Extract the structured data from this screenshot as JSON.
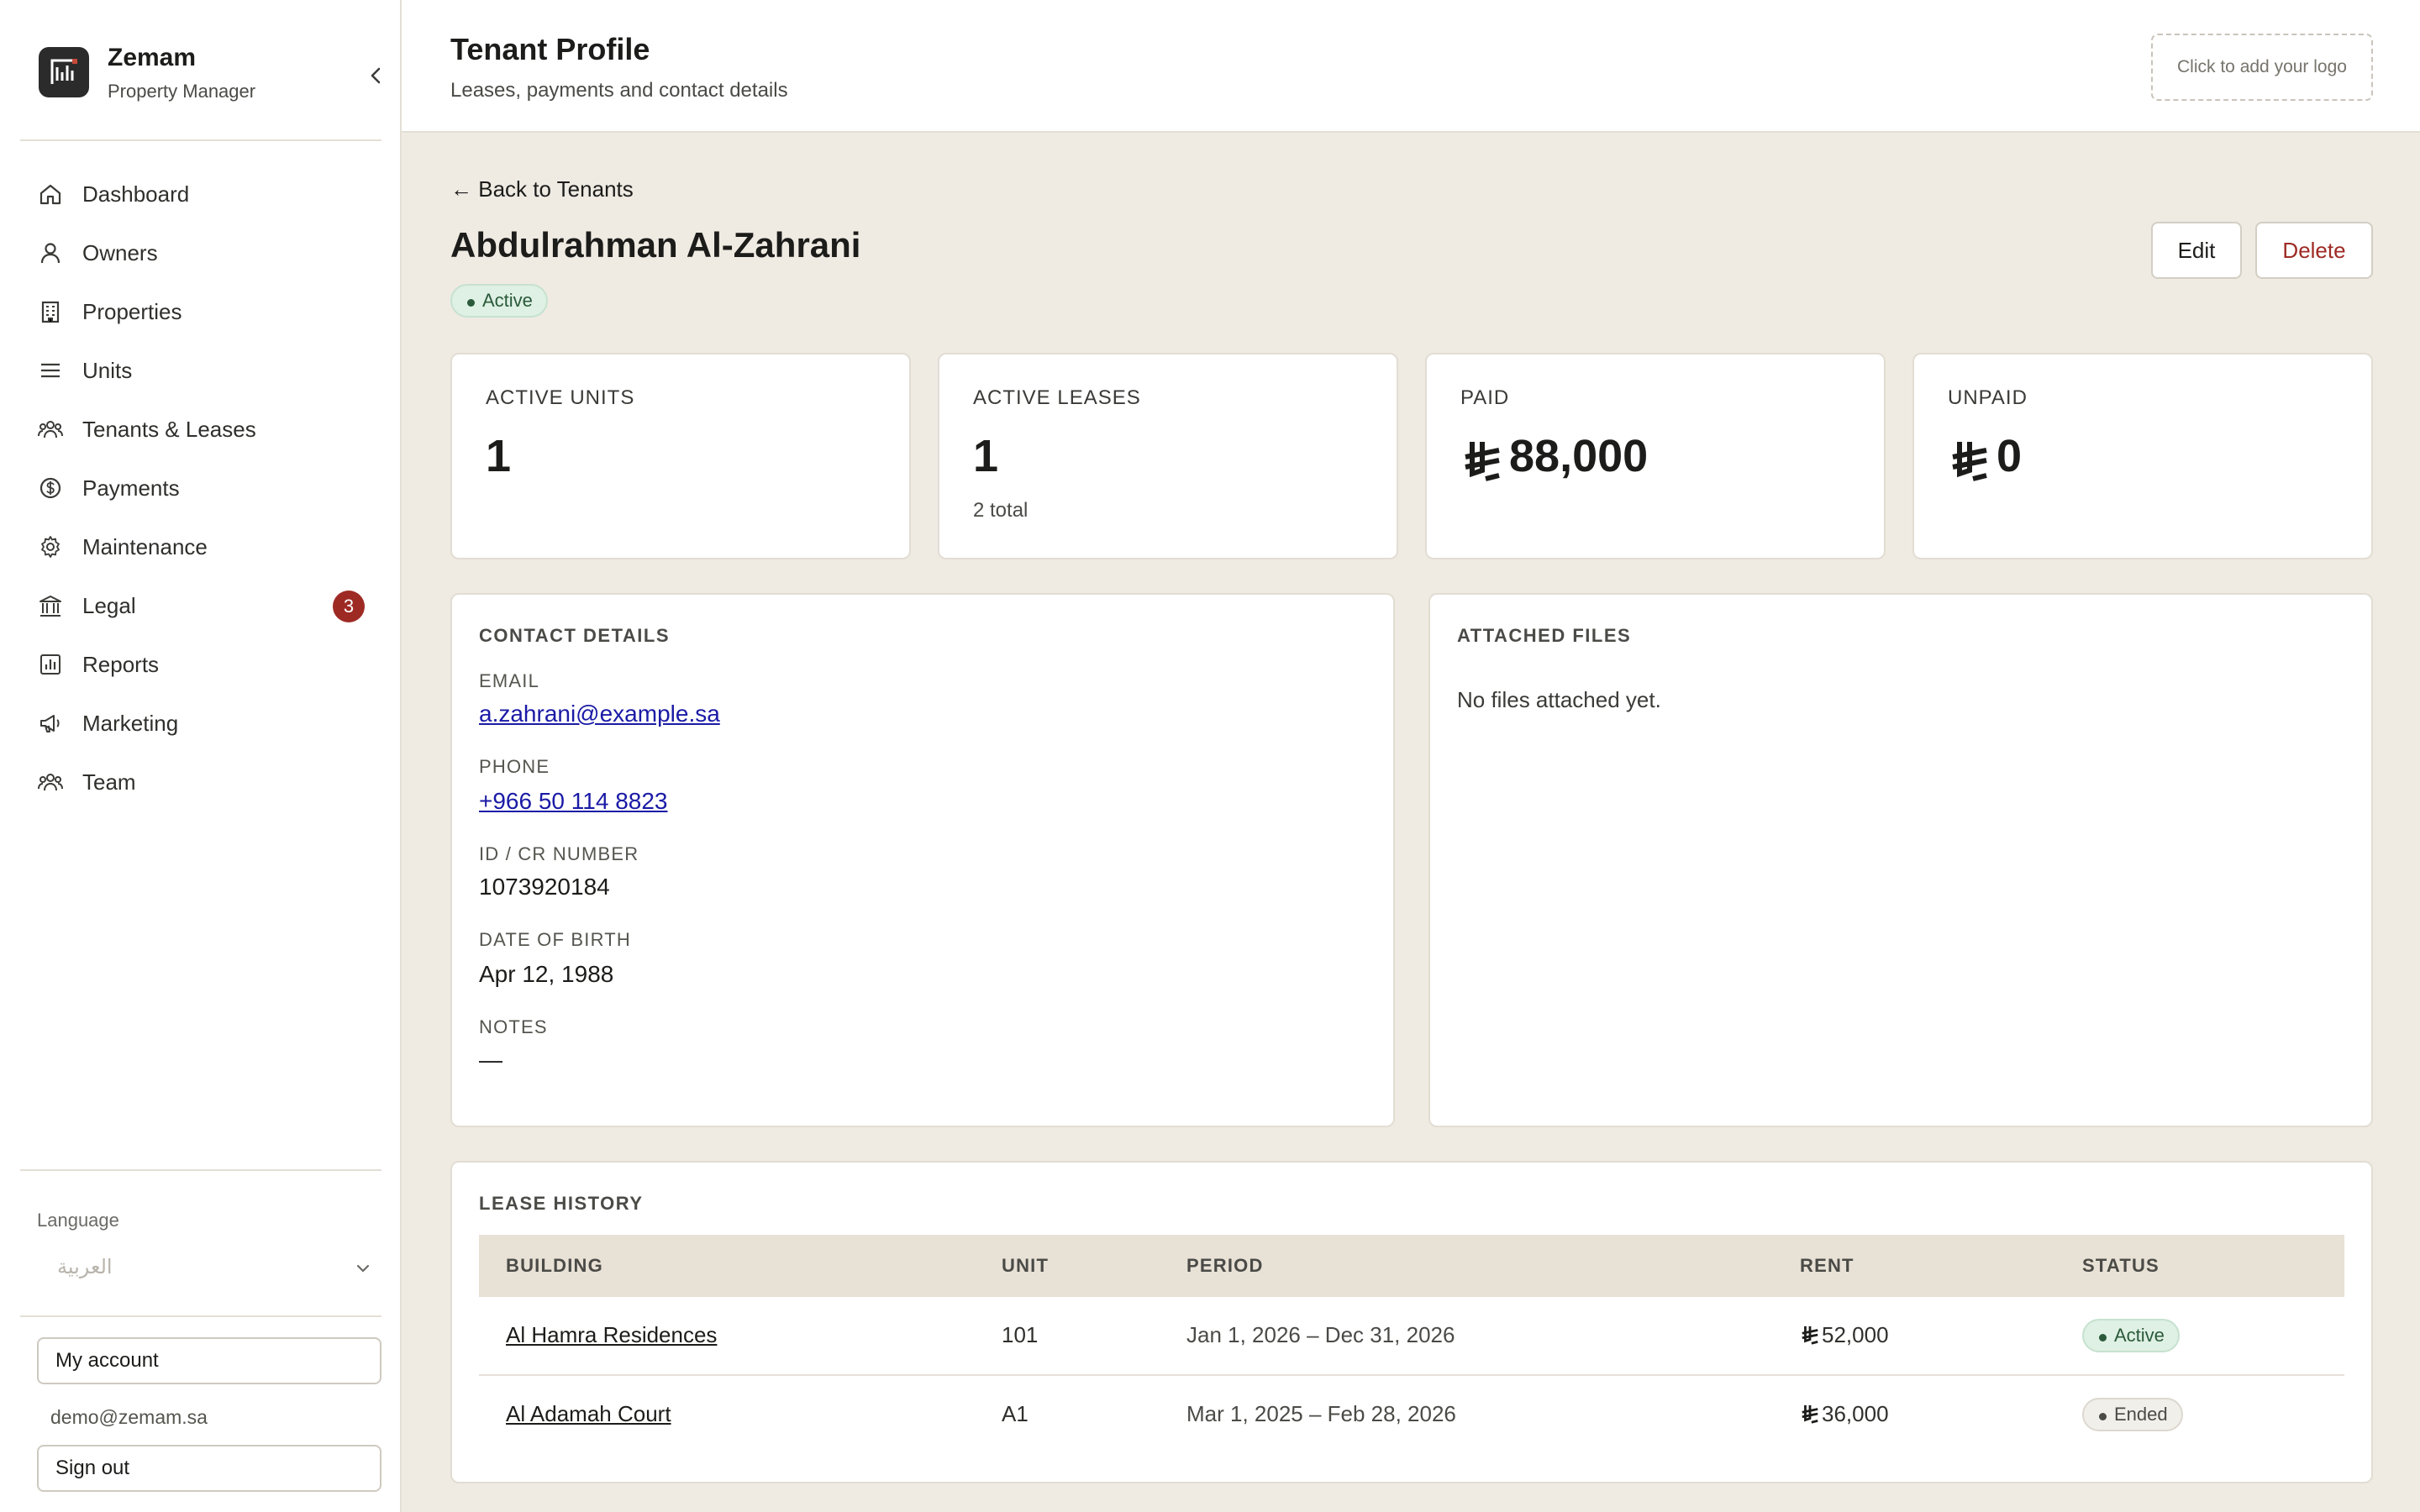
{
  "brand": {
    "name": "Zemam",
    "subtitle": "Property Manager"
  },
  "sidebar": {
    "items": [
      {
        "label": "Dashboard",
        "icon": "home-icon"
      },
      {
        "label": "Owners",
        "icon": "user-icon"
      },
      {
        "label": "Properties",
        "icon": "building-icon"
      },
      {
        "label": "Units",
        "icon": "list-icon"
      },
      {
        "label": "Tenants & Leases",
        "icon": "users-icon"
      },
      {
        "label": "Payments",
        "icon": "dollar-circle-icon"
      },
      {
        "label": "Maintenance",
        "icon": "gear-icon"
      },
      {
        "label": "Legal",
        "icon": "bank-icon",
        "badge": "3"
      },
      {
        "label": "Reports",
        "icon": "bar-chart-icon"
      },
      {
        "label": "Marketing",
        "icon": "megaphone-icon"
      },
      {
        "label": "Team",
        "icon": "team-icon"
      }
    ],
    "language_label": "Language",
    "language_value": "العربية",
    "my_account": "My account",
    "email": "demo@zemam.sa",
    "sign_out": "Sign out"
  },
  "header": {
    "title": "Tenant Profile",
    "subtitle": "Leases, payments and contact details",
    "logo_placeholder": "Click to add your logo"
  },
  "tenant": {
    "back_link": "← Back to Tenants",
    "name": "Abdulrahman Al-Zahrani",
    "status": "Active",
    "edit": "Edit",
    "delete": "Delete"
  },
  "stats": [
    {
      "label": "ACTIVE UNITS",
      "value": "1",
      "note": ""
    },
    {
      "label": "ACTIVE LEASES",
      "value": "1",
      "note": "2 total"
    },
    {
      "label": "PAID",
      "value": "88,000",
      "currency": true,
      "note": ""
    },
    {
      "label": "UNPAID",
      "value": "0",
      "currency": true,
      "note": ""
    }
  ],
  "contact": {
    "title": "CONTACT DETAILS",
    "email_label": "EMAIL",
    "email": "a.zahrani@example.sa",
    "phone_label": "PHONE",
    "phone": "+966 50 114 8823",
    "id_label": "ID / CR NUMBER",
    "id": "1073920184",
    "dob_label": "DATE OF BIRTH",
    "dob": "Apr 12, 1988",
    "notes_label": "NOTES",
    "notes": "—"
  },
  "files": {
    "title": "ATTACHED FILES",
    "empty": "No files attached yet."
  },
  "lease_history": {
    "title": "LEASE HISTORY",
    "columns": [
      "BUILDING",
      "UNIT",
      "PERIOD",
      "RENT",
      "STATUS"
    ],
    "rows": [
      {
        "building": "Al Hamra Residences",
        "unit": "101",
        "period": "Jan 1, 2026 – Dec 31, 2026",
        "rent": "52,000",
        "status": "Active"
      },
      {
        "building": "Al Adamah Court",
        "unit": "A1",
        "period": "Mar 1, 2025 – Feb 28, 2026",
        "rent": "36,000",
        "status": "Ended"
      }
    ]
  },
  "colors": {
    "accent_danger": "#9e2a24",
    "background": "#efebe3",
    "active_pill": "#dff0e4",
    "table_header": "#e8e1d6"
  }
}
